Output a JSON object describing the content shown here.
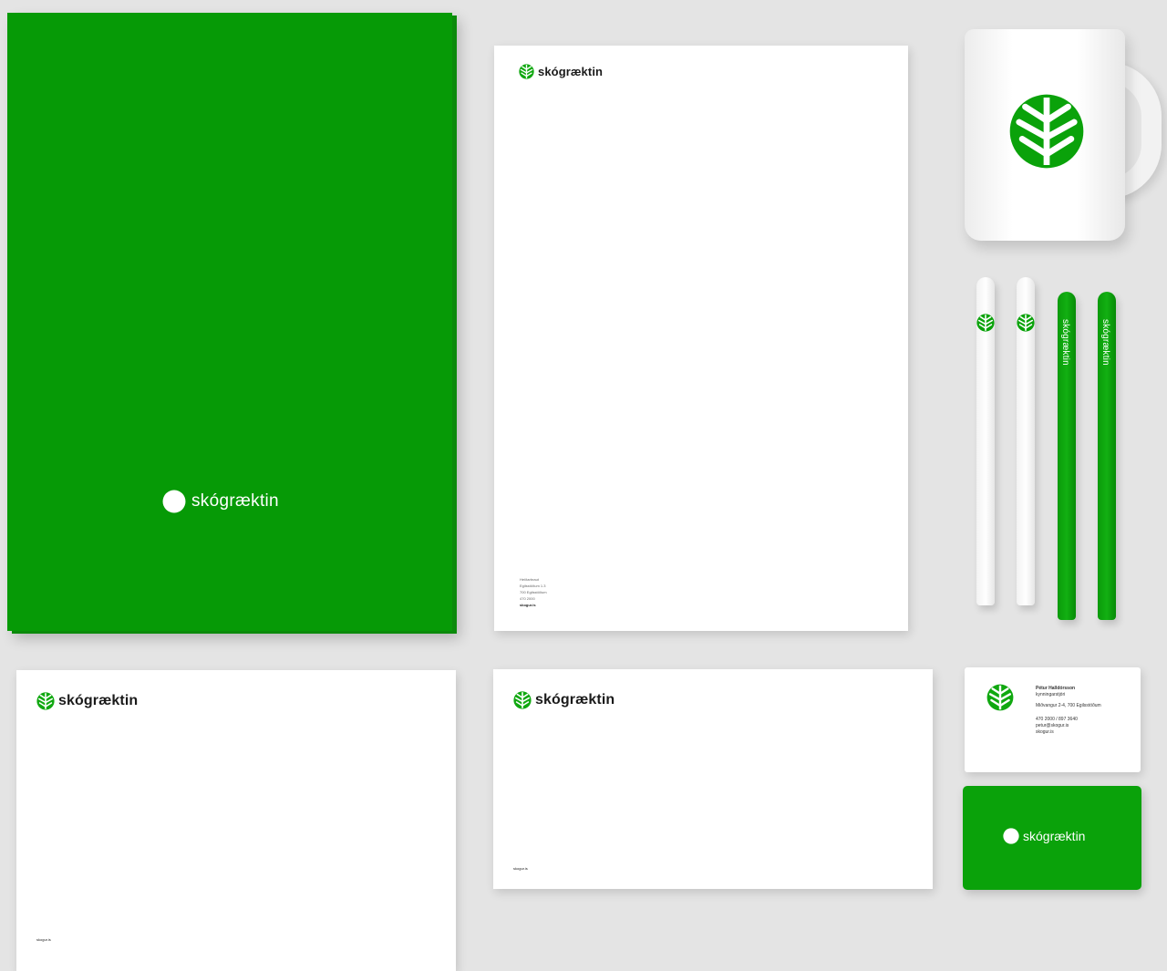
{
  "brand": {
    "name": "skógræktin",
    "green": "#069a06",
    "logo_icon": "tree-leaf-icon"
  },
  "letterhead": {
    "footer_lines": [
      "Heiðarbraut",
      "Egilsstöðum 1.3",
      "700 Egilsstöðum",
      "470 2000",
      "skogur.is"
    ]
  },
  "note": {
    "footer": "skogur.is"
  },
  "envelope": {
    "footer": "skogur.is"
  },
  "business_card": {
    "name": "Pétur Halldórsson",
    "role": "kynningarstjóri",
    "address": "Miðvangur 2-4, 700 Egilsstöðum",
    "phone": "470 2000 / 897 3640",
    "email": "petur@skogur.is",
    "web": "skogur.is"
  },
  "pens": {
    "label": "skógræktin"
  }
}
